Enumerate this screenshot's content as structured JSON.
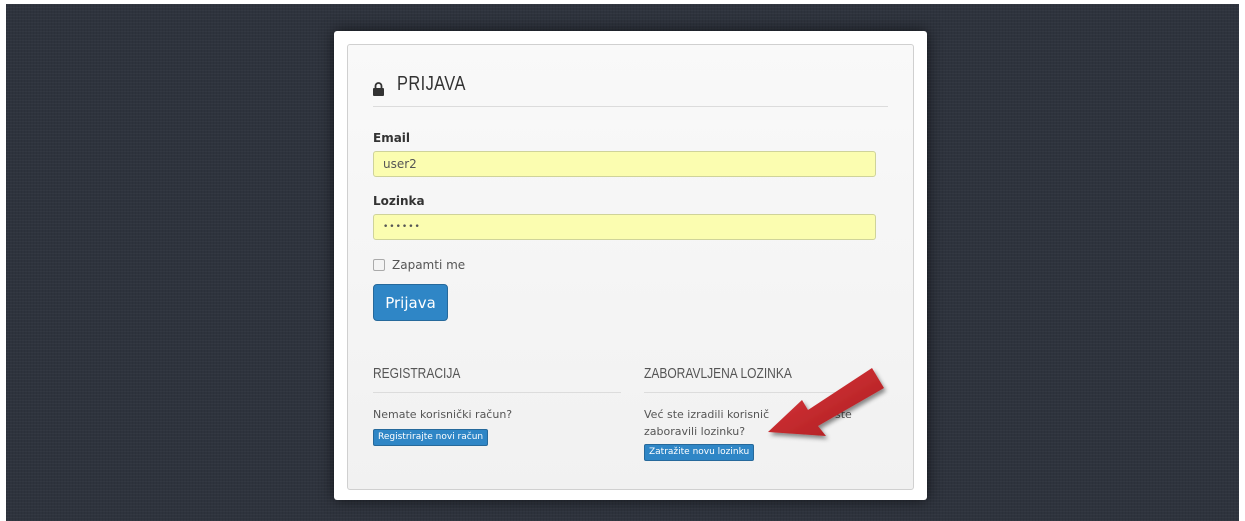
{
  "login": {
    "title": "PRIJAVA",
    "email_label": "Email",
    "email_value": "user2",
    "password_label": "Lozinka",
    "password_value": "••••••",
    "remember_label": "Zapamti me",
    "submit_label": "Prijava"
  },
  "register": {
    "title": "REGISTRACIJA",
    "text": "Nemate korisnički račun?",
    "button_label": "Registrirajte novi račun"
  },
  "forgot": {
    "title": "ZABORAVLJENA LOZINKA",
    "text_line1": "Već ste izradili korisnič",
    "text_line1_tail": "ste",
    "text_line2": "zaboravili lozinku?",
    "button_label": "Zatražite novu lozinku"
  },
  "colors": {
    "background": "#2e333d",
    "accent": "#2f86c6",
    "input_fill": "#fbfdb0",
    "arrow": "#c8262a"
  }
}
